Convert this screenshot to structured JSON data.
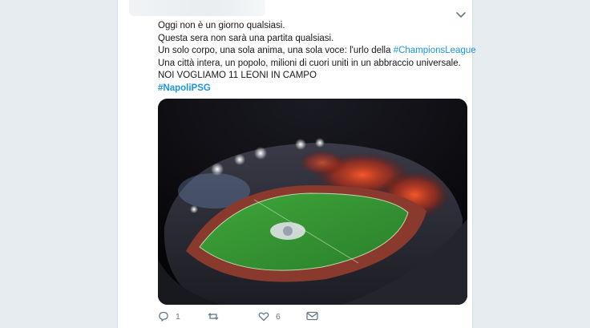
{
  "tweet": {
    "lines": [
      "Oggi non è un giorno qualsiasi.",
      "Questa sera non sarà una partita qualsiasi.",
      "Un solo corpo, una sola anima, una sola voce: l'urlo della ",
      "Una città intera, un popolo, milioni di cuori uniti in un abbraccio universale.",
      "NOI VOGLIAMO 11 LEONI IN CAMPO"
    ],
    "inline_hashtag": "#ChampionsLeague",
    "hashtag_line": "#NapoliPSG",
    "link_color": "#1b95e0"
  },
  "actions": {
    "reply_count": "1",
    "retweet_count": "",
    "like_count": "6"
  }
}
